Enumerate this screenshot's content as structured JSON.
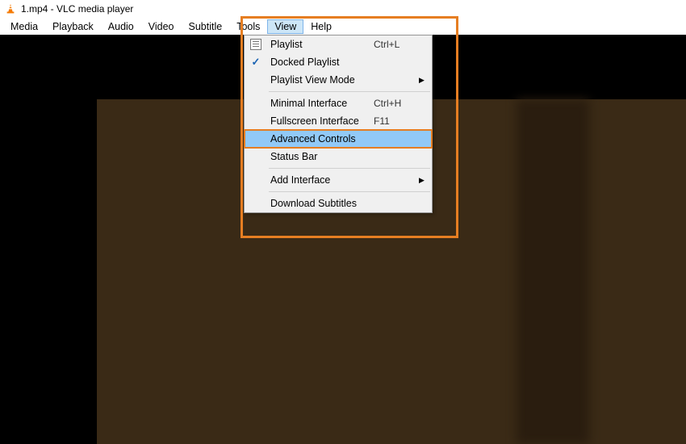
{
  "title": "1.mp4 - VLC media player",
  "menubar": {
    "media": "Media",
    "playback": "Playback",
    "audio": "Audio",
    "video": "Video",
    "subtitle": "Subtitle",
    "tools": "Tools",
    "view": "View",
    "help": "Help"
  },
  "view_menu": {
    "playlist": {
      "label": "Playlist",
      "accel": "Ctrl+L"
    },
    "docked_playlist": {
      "label": "Docked Playlist"
    },
    "playlist_view_mode": {
      "label": "Playlist View Mode"
    },
    "minimal_interface": {
      "label": "Minimal Interface",
      "accel": "Ctrl+H"
    },
    "fullscreen_interface": {
      "label": "Fullscreen Interface",
      "accel": "F11"
    },
    "advanced_controls": {
      "label": "Advanced Controls"
    },
    "status_bar": {
      "label": "Status Bar"
    },
    "add_interface": {
      "label": "Add Interface"
    },
    "download_subtitles": {
      "label": "Download Subtitles"
    }
  }
}
